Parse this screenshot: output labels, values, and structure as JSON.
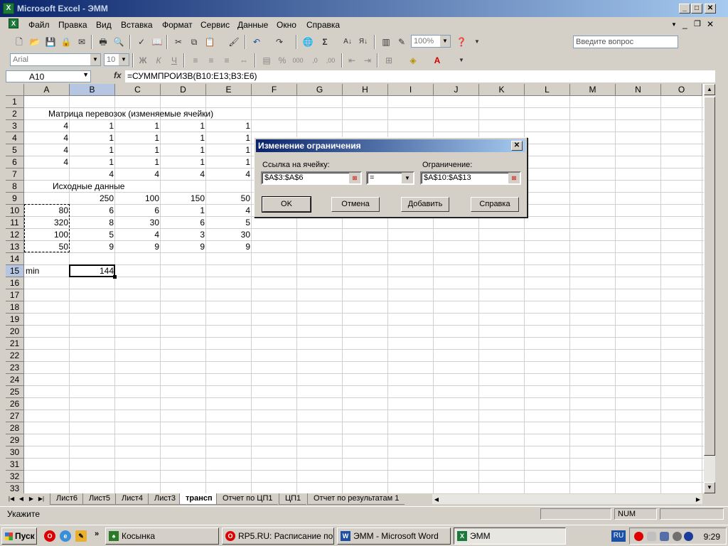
{
  "window": {
    "title": "Microsoft Excel - ЭММ",
    "app_icon": "excel-icon"
  },
  "menu": [
    "Файл",
    "Правка",
    "Вид",
    "Вставка",
    "Формат",
    "Сервис",
    "Данные",
    "Окно",
    "Справка"
  ],
  "ask_box": {
    "placeholder": "Введите вопрос"
  },
  "toolbar": {
    "zoom": "100%"
  },
  "format_toolbar": {
    "font": "Arial",
    "size": "10",
    "bold": "Ж",
    "italic": "К",
    "underline": "Ч",
    "percent": "%",
    "thousands": "000"
  },
  "formula_bar": {
    "name_box": "A10",
    "fx": "fx",
    "formula": "=СУММПРОИЗВ(B10:E13;B3:E6)"
  },
  "columns": [
    "A",
    "B",
    "C",
    "D",
    "E",
    "F",
    "G",
    "H",
    "I",
    "J",
    "K",
    "L",
    "M",
    "N",
    "O"
  ],
  "rows": [
    "1",
    "2",
    "3",
    "4",
    "5",
    "6",
    "7",
    "8",
    "9",
    "10",
    "11",
    "12",
    "13",
    "14",
    "15",
    "16",
    "17",
    "18",
    "19",
    "20",
    "21",
    "22",
    "23",
    "24",
    "25",
    "26",
    "27",
    "28",
    "29",
    "30",
    "31",
    "32",
    "33"
  ],
  "cells": {
    "A2": "Матрица перевозок (изменяемые ячейки)",
    "A3": "4",
    "B3": "1",
    "C3": "1",
    "D3": "1",
    "E3": "1",
    "A4": "4",
    "B4": "1",
    "C4": "1",
    "D4": "1",
    "E4": "1",
    "A5": "4",
    "B5": "1",
    "C5": "1",
    "D5": "1",
    "E5": "1",
    "A6": "4",
    "B6": "1",
    "C6": "1",
    "D6": "1",
    "E6": "1",
    "B7": "4",
    "C7": "4",
    "D7": "4",
    "E7": "4",
    "A8": "Исходные данные",
    "B9": "250",
    "C9": "100",
    "D9": "150",
    "E9": "50",
    "A10": "80",
    "B10": "6",
    "C10": "6",
    "D10": "1",
    "E10": "4",
    "A11": "320",
    "B11": "8",
    "C11": "30",
    "D11": "6",
    "E11": "5",
    "A12": "100",
    "B12": "5",
    "C12": "4",
    "D12": "3",
    "E12": "30",
    "A13": "50",
    "B13": "9",
    "C13": "9",
    "D13": "9",
    "E13": "9",
    "A15": "min",
    "B15": "144"
  },
  "sheet_tabs": [
    "Лист6",
    "Лист5",
    "Лист4",
    "Лист3",
    "трансп",
    "Отчет по ЦП1",
    "ЦП1",
    "Отчет по результатам 1"
  ],
  "active_tab": "трансп",
  "status": {
    "text": "Укажите",
    "num": "NUM"
  },
  "dialog": {
    "title": "Изменение ограничения",
    "ref_label": "Ссылка на ячейку:",
    "ref_value": "$A$3:$A$6",
    "op_value": "=",
    "constraint_label": "Ограничение:",
    "constraint_value": "$A$10:$A$13",
    "ok": "OK",
    "cancel": "Отмена",
    "add": "Добавить",
    "help": "Справка"
  },
  "taskbar": {
    "start": "Пуск",
    "tasks": [
      "Косынка",
      "RP5.RU: Расписание по...",
      "ЭММ - Microsoft Word",
      "ЭММ"
    ],
    "lang": "RU",
    "time": "9:29"
  }
}
